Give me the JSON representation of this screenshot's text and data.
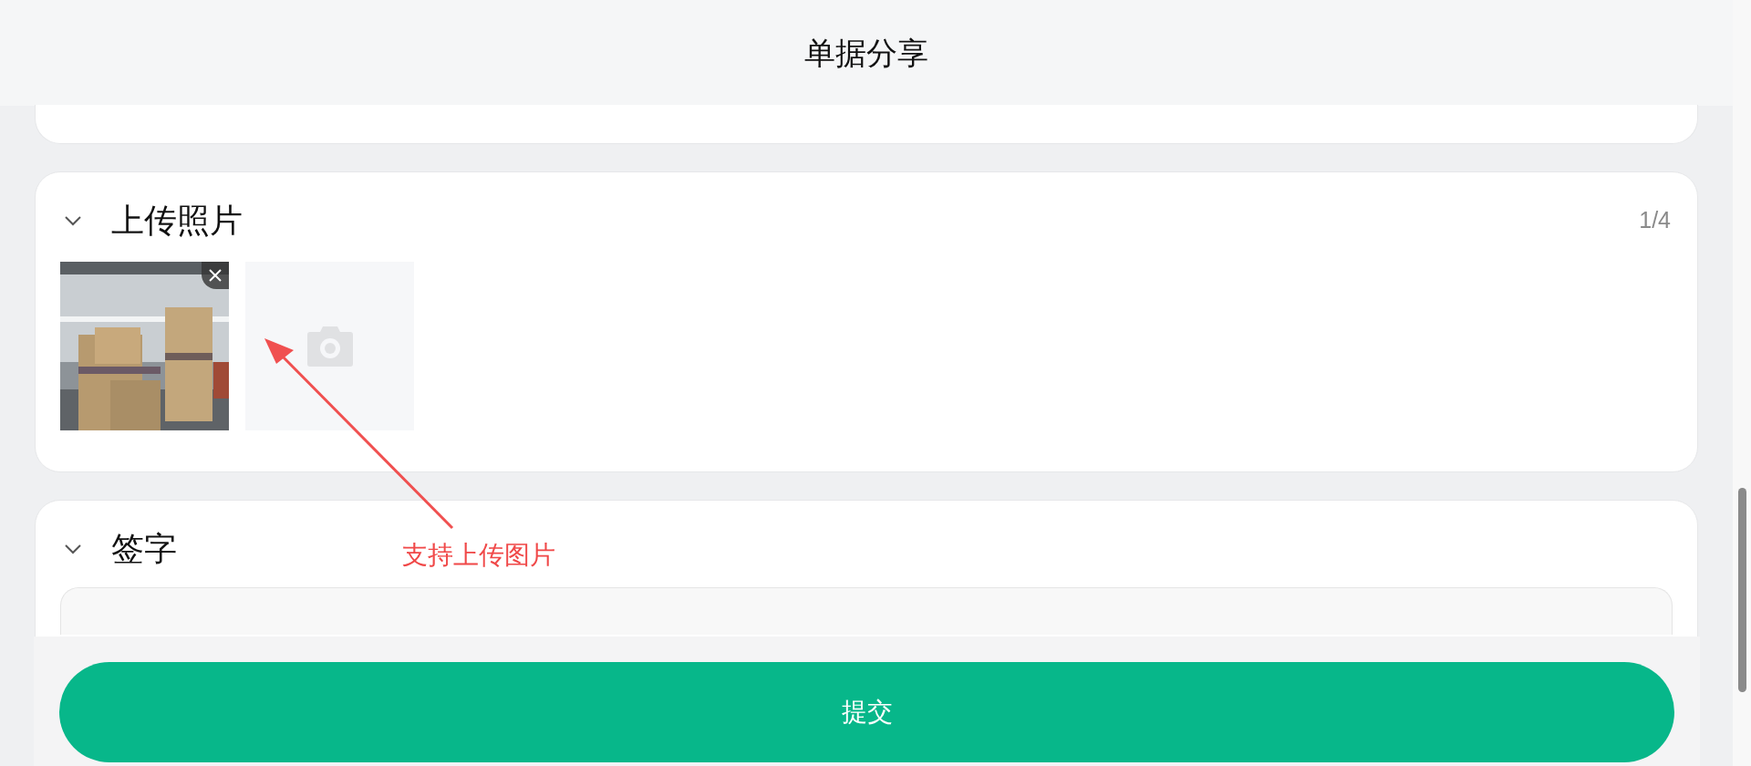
{
  "header": {
    "title": "单据分享"
  },
  "photo_section": {
    "title": "上传照片",
    "expanded": true,
    "count": "1/4",
    "add_photo": true
  },
  "signature_section": {
    "title": "签字",
    "expanded": true
  },
  "annotation": {
    "text": "支持上传图片"
  },
  "submit_button": {
    "label": "提交"
  }
}
